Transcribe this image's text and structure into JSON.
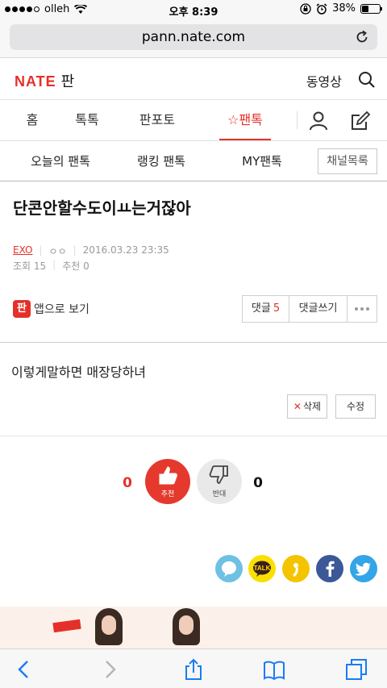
{
  "status_bar": {
    "carrier": "olleh",
    "time": "오후 8:39",
    "battery": "38%",
    "battery_level": 0.38
  },
  "browser": {
    "url": "pann.nate.com"
  },
  "header": {
    "logo_nate": "NATE",
    "logo_pan": "판",
    "video_link": "동영상"
  },
  "main_nav": {
    "tabs": [
      {
        "label": "홈"
      },
      {
        "label": "톡톡"
      },
      {
        "label": "판포토"
      },
      {
        "label": "☆팬톡",
        "active": true
      }
    ]
  },
  "sub_nav": {
    "items": [
      {
        "label": "오늘의 팬톡"
      },
      {
        "label": "랭킹 팬톡"
      },
      {
        "label": "MY팬톡"
      }
    ],
    "channel_button": "채널목록"
  },
  "post": {
    "title": "단콘안할수도이ㅛ는거잖아",
    "category": "EXO",
    "author": "ㅇㅇ",
    "date": "2016.03.23 23:35",
    "views": "조회 15",
    "recommends": "추천 0",
    "app_view": "앱으로 보기",
    "app_icon": "판",
    "comment_label": "댓글",
    "comment_count": "5",
    "write_comment": "댓글쓰기",
    "content": "이렇게말하면 매장당하녀",
    "delete_label": "삭제",
    "edit_label": "수정"
  },
  "vote": {
    "up_count": "0",
    "up_label": "추천",
    "down_count": "0",
    "down_label": "반대"
  },
  "share": {
    "talk_label": "TALK"
  },
  "colors": {
    "brand_red": "#e5302a",
    "facebook": "#3b5998",
    "twitter": "#34a5e6",
    "kakao": "#f9e000"
  }
}
